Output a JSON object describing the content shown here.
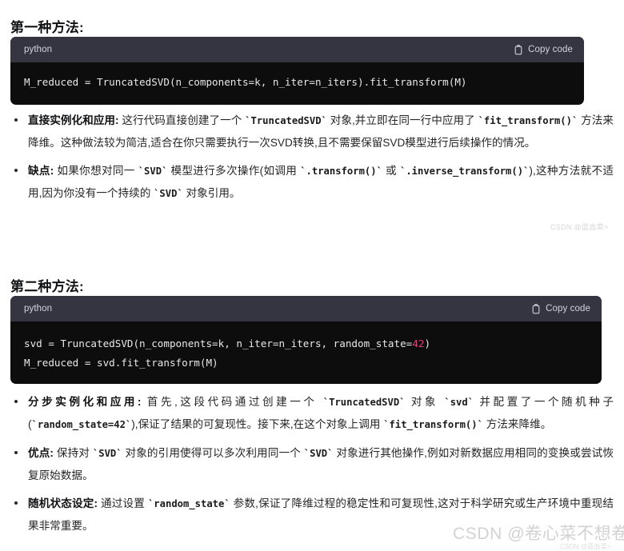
{
  "sections": [
    {
      "heading": "第一种方法:",
      "code_block": {
        "language_label": "python",
        "copy_label": "Copy code",
        "copy_icon": "clipboard-icon",
        "lines": [
          {
            "parts": [
              {
                "text": "M_reduced = TruncatedSVD(n_components=k, n_iter=n_iters).fit_transform(M)",
                "type": "plain"
              }
            ]
          }
        ]
      },
      "bullets": [
        {
          "lead": "直接实例化和应用:",
          "rest": " 这行代码直接创建了一个 `TruncatedSVD` 对象,并立即在同一行中应用了 `fit_transform()` 方法来降维。这种做法较为简洁,适合在你只需要执行一次SVD转换,且不需要保留SVD模型进行后续操作的情况。"
        },
        {
          "lead": "缺点:",
          "rest": " 如果你想对同一 `SVD` 模型进行多次操作(如调用 `.transform()` 或 `.inverse_transform()`),这种方法就不适用,因为你没有一个持续的 `SVD` 对象引用。"
        }
      ]
    },
    {
      "heading": "第二种方法:",
      "code_block": {
        "language_label": "python",
        "copy_label": "Copy code",
        "copy_icon": "clipboard-icon",
        "lines": [
          {
            "parts": [
              {
                "text": "svd = TruncatedSVD(n_components=k, n_iter=n_iters, random_state=",
                "type": "plain"
              },
              {
                "text": "42",
                "type": "number"
              },
              {
                "text": ")",
                "type": "plain"
              }
            ]
          },
          {
            "parts": [
              {
                "text": "M_reduced = svd.fit_transform(M)",
                "type": "plain"
              }
            ]
          }
        ]
      },
      "bullets": [
        {
          "lead": "分步实例化和应用:",
          "rest": " 首先,这段代码通过创建一个 `TruncatedSVD` 对象 `svd` 并配置了一个随机种子(`random_state=42`),保证了结果的可复现性。接下来,在这个对象上调用 `fit_transform()` 方法来降维。"
        },
        {
          "lead": "优点:",
          "rest": " 保持对 `SVD` 对象的引用使得可以多次利用同一个 `SVD` 对象进行其他操作,例如对新数据应用相同的变换或尝试恢复原始数据。"
        },
        {
          "lead": "随机状态设定:",
          "rest": " 通过设置 `random_state` 参数,保证了降维过程的稳定性和可复现性,这对于科学研究或生产环境中重现结果非常重要。"
        }
      ]
    }
  ],
  "watermarks": {
    "mid": "CSDN @蓝血菜>",
    "main": "CSDN @卷心菜不想卷",
    "small": "CSDN @蓝血菜>"
  },
  "colors": {
    "code_header_bg": "#343541",
    "code_body_bg": "#0d0d0d",
    "code_text": "#e8e8e8",
    "number_token": "#e0407b",
    "page_bg": "#ffffff",
    "body_text": "#262626"
  }
}
